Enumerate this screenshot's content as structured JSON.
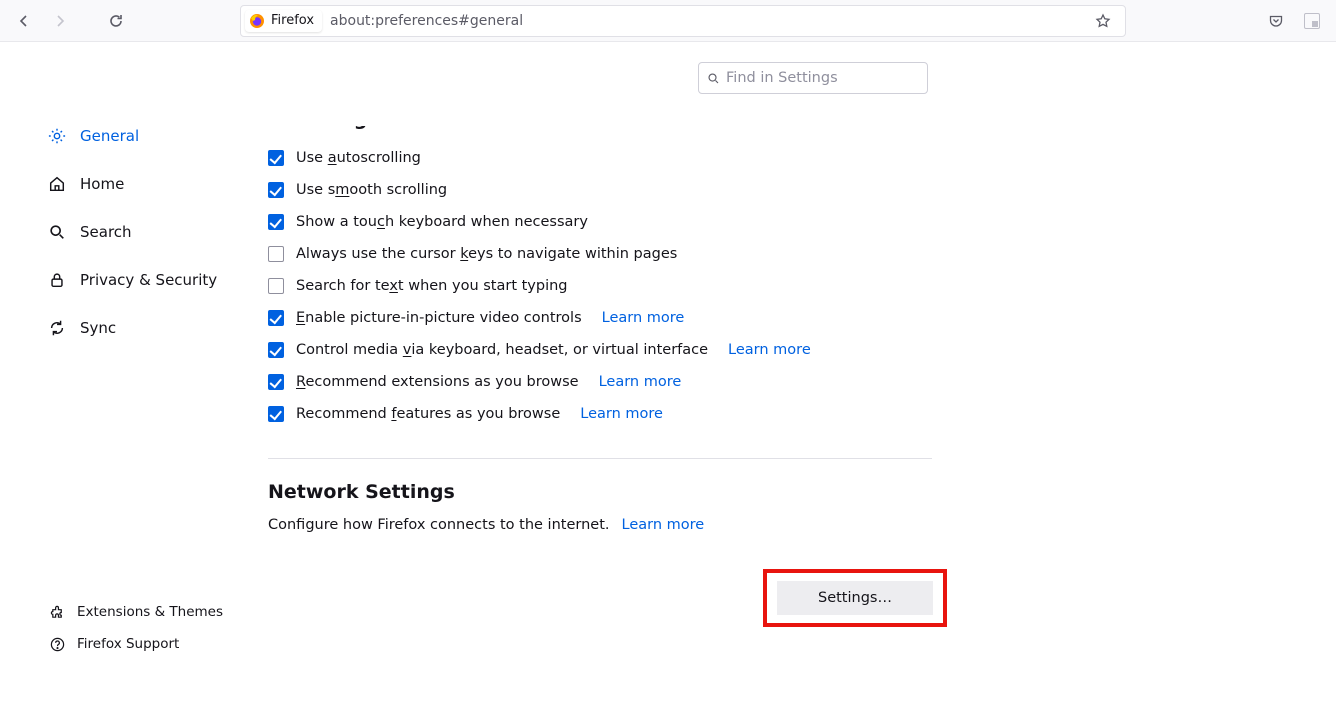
{
  "toolbar": {
    "identity_label": "Firefox",
    "url": "about:preferences#general"
  },
  "search": {
    "placeholder": "Find in Settings"
  },
  "sidebar": {
    "items": [
      {
        "label": "General"
      },
      {
        "label": "Home"
      },
      {
        "label": "Search"
      },
      {
        "label": "Privacy & Security"
      },
      {
        "label": "Sync"
      }
    ],
    "bottom": [
      {
        "label": "Extensions & Themes"
      },
      {
        "label": "Firefox Support"
      }
    ]
  },
  "browsing": {
    "heading": "Browsing",
    "items": [
      {
        "label_pre": "Use ",
        "u": "a",
        "label_post": "utoscrolling",
        "checked": true
      },
      {
        "label_pre": "Use s",
        "u": "m",
        "label_post": "ooth scrolling",
        "checked": true
      },
      {
        "label_pre": "Show a tou",
        "u": "c",
        "label_post": "h keyboard when necessary",
        "checked": true
      },
      {
        "label_pre": "Always use the cursor ",
        "u": "k",
        "label_post": "eys to navigate within pages",
        "checked": false
      },
      {
        "label_pre": "Search for te",
        "u": "x",
        "label_post": "t when you start typing",
        "checked": false
      },
      {
        "label_pre": "",
        "u": "E",
        "label_post": "nable picture-in-picture video controls",
        "checked": true,
        "learn_more": "Learn more"
      },
      {
        "label_pre": "Control media ",
        "u": "v",
        "label_post": "ia keyboard, headset, or virtual interface",
        "checked": true,
        "learn_more": "Learn more"
      },
      {
        "label_pre": "",
        "u": "R",
        "label_post": "ecommend extensions as you browse",
        "checked": true,
        "learn_more": "Learn more"
      },
      {
        "label_pre": "Recommend ",
        "u": "f",
        "label_post": "eatures as you browse",
        "checked": true,
        "learn_more": "Learn more"
      }
    ]
  },
  "network": {
    "heading": "Network Settings",
    "desc": "Configure how Firefox connects to the internet.",
    "learn_more": "Learn more",
    "button": "Settings…"
  }
}
